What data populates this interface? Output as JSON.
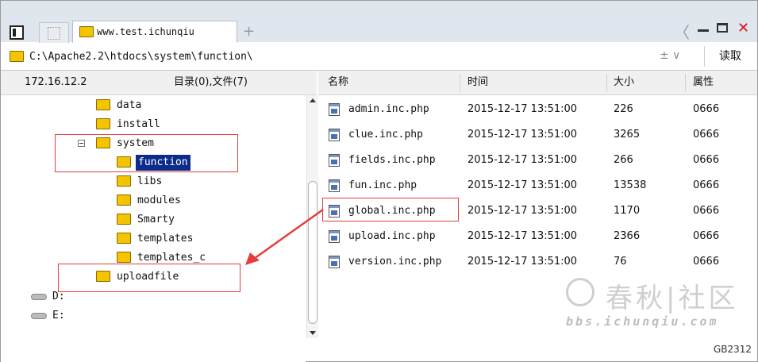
{
  "window": {
    "tab_title": "www.test.ichunqiu",
    "new_tab": "+",
    "back": "〈",
    "close": "✕"
  },
  "path": {
    "value": "C:\\Apache2.2\\htdocs\\system\\function\\",
    "controls": "±  ∨",
    "read_button": "读取"
  },
  "left_header": {
    "host": "172.16.12.2",
    "summary": "目录(0),文件(7)"
  },
  "columns": [
    "名称",
    "时间",
    "大小",
    "属性"
  ],
  "tree": [
    {
      "label": "data"
    },
    {
      "label": "install"
    },
    {
      "label": "system"
    },
    {
      "label": "function"
    },
    {
      "label": "libs"
    },
    {
      "label": "modules"
    },
    {
      "label": "Smarty"
    },
    {
      "label": "templates"
    },
    {
      "label": "templates_c"
    },
    {
      "label": "uploadfile"
    }
  ],
  "drives": [
    "D:",
    "E:"
  ],
  "files": [
    {
      "name": "admin.inc.php",
      "time": "2015-12-17 13:51:00",
      "size": "226",
      "attr": "0666"
    },
    {
      "name": "clue.inc.php",
      "time": "2015-12-17 13:51:00",
      "size": "3265",
      "attr": "0666"
    },
    {
      "name": "fields.inc.php",
      "time": "2015-12-17 13:51:00",
      "size": "266",
      "attr": "0666"
    },
    {
      "name": "fun.inc.php",
      "time": "2015-12-17 13:51:00",
      "size": "13538",
      "attr": "0666"
    },
    {
      "name": "global.inc.php",
      "time": "2015-12-17 13:51:00",
      "size": "1170",
      "attr": "0666"
    },
    {
      "name": "upload.inc.php",
      "time": "2015-12-17 13:51:00",
      "size": "2366",
      "attr": "0666"
    },
    {
      "name": "version.inc.php",
      "time": "2015-12-17 13:51:00",
      "size": "76",
      "attr": "0666"
    }
  ],
  "watermark": {
    "brand": "春秋|社区",
    "url": "bbs.ichunqiu.com"
  },
  "encoding": "GB2312",
  "colors": {
    "selection": "#0b2c8a",
    "annotation": "#e53c3c",
    "folder": "#f5c400",
    "close": "#e01010"
  }
}
